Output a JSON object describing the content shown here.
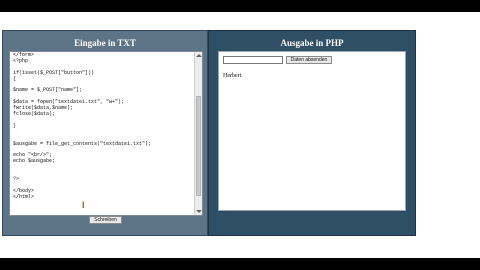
{
  "left_panel": {
    "title": "Eingabe in TXT",
    "code": "</form>\n<?php\n\nif(isset($_POST[\"button\"]))\n{\n\n$name = $_POST[\"name\"];\n\n$data = fopen(\"textdatei.txt\", \"w+\");\nfwrite($data,$name);\nfclose($data);\n\n}\n\n\n$ausgabe = file_get_contents(\"textdatei.txt\");\n\necho \"<br/>\";\necho $ausgabe;\n\n\n?>\n\n</body>\n</html>",
    "button_label": "Schreiben",
    "cursor_glyph": "I"
  },
  "right_panel": {
    "title": "Ausgabe in PHP",
    "input_value": "",
    "button_label": "Daten absenden",
    "output_text": "Herbert"
  },
  "colors": {
    "left_bg": "#5d7486",
    "right_bg": "#2e4f65"
  }
}
